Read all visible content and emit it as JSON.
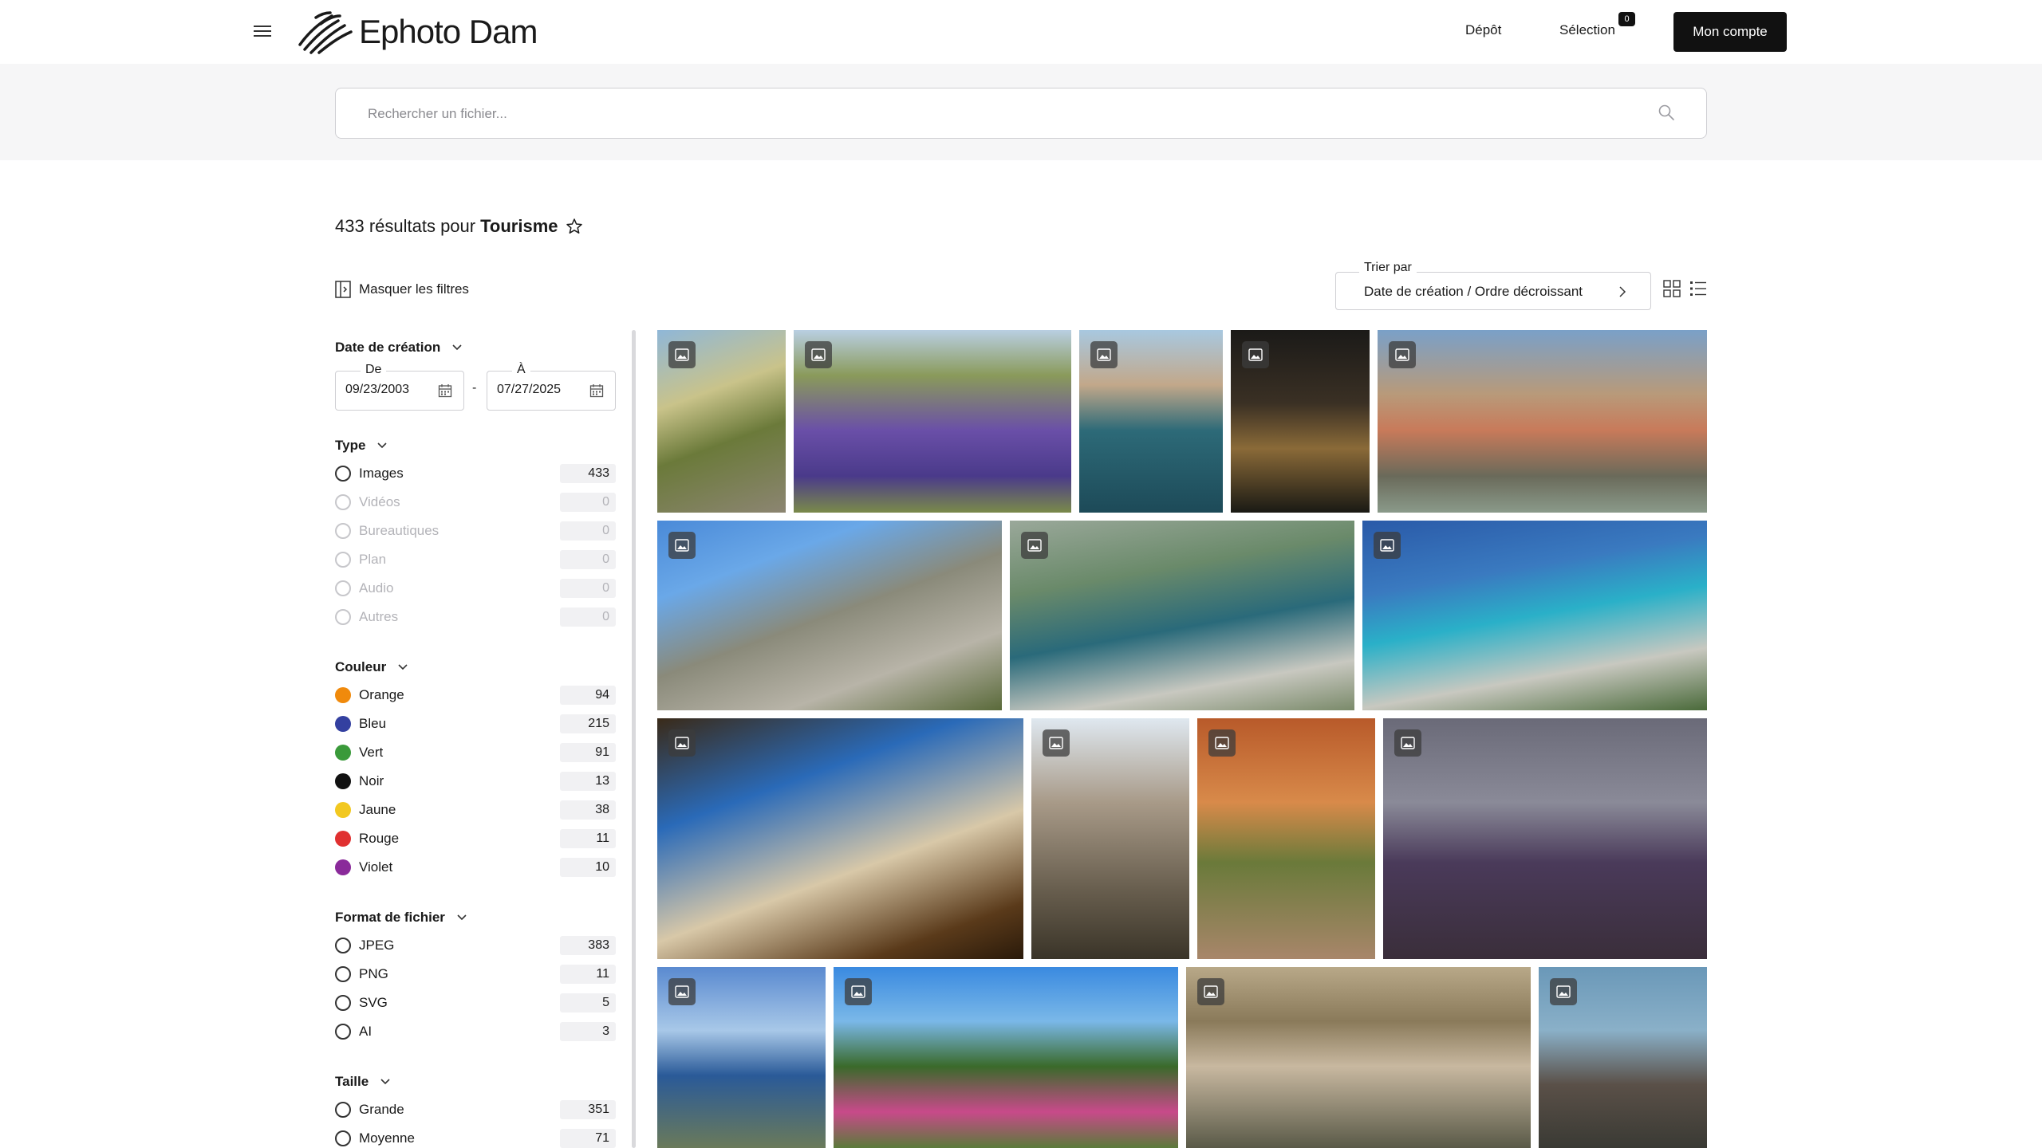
{
  "header": {
    "logo_text": "Ephoto Dam",
    "nav": {
      "depot": "Dépôt",
      "selection": "Sélection",
      "selection_count": "0"
    },
    "account_button": "Mon compte"
  },
  "search": {
    "placeholder": "Rechercher un fichier..."
  },
  "results": {
    "count_text": "433 résultats pour",
    "query": "Tourisme"
  },
  "filters_toggle": "Masquer les filtres",
  "sort": {
    "caption": "Trier par",
    "value": "Date de création / Ordre décroissant"
  },
  "filters": {
    "date": {
      "title": "Date de création",
      "from_label": "De",
      "from_value": "09/23/2003",
      "to_label": "À",
      "to_value": "07/27/2025"
    },
    "type": {
      "title": "Type",
      "items": [
        {
          "label": "Images",
          "count": "433",
          "enabled": true
        },
        {
          "label": "Vidéos",
          "count": "0",
          "enabled": false
        },
        {
          "label": "Bureautiques",
          "count": "0",
          "enabled": false
        },
        {
          "label": "Plan",
          "count": "0",
          "enabled": false
        },
        {
          "label": "Audio",
          "count": "0",
          "enabled": false
        },
        {
          "label": "Autres",
          "count": "0",
          "enabled": false
        }
      ]
    },
    "color": {
      "title": "Couleur",
      "items": [
        {
          "label": "Orange",
          "count": "94",
          "color": "#f08a0c"
        },
        {
          "label": "Bleu",
          "count": "215",
          "color": "#3340a0"
        },
        {
          "label": "Vert",
          "count": "91",
          "color": "#3a9a3a"
        },
        {
          "label": "Noir",
          "count": "13",
          "color": "#111111"
        },
        {
          "label": "Jaune",
          "count": "38",
          "color": "#f2c820"
        },
        {
          "label": "Rouge",
          "count": "11",
          "color": "#e03030"
        },
        {
          "label": "Violet",
          "count": "10",
          "color": "#8a2a9a"
        }
      ]
    },
    "format": {
      "title": "Format de fichier",
      "items": [
        {
          "label": "JPEG",
          "count": "383"
        },
        {
          "label": "PNG",
          "count": "11"
        },
        {
          "label": "SVG",
          "count": "5"
        },
        {
          "label": "AI",
          "count": "3"
        }
      ]
    },
    "size": {
      "title": "Taille",
      "items": [
        {
          "label": "Grande",
          "count": "351"
        },
        {
          "label": "Moyenne",
          "count": "71"
        }
      ]
    }
  },
  "gallery": {
    "badge_icon": "image-icon",
    "tiles": [
      {
        "name": "photo-stone-path",
        "background": "linear-gradient(160deg,#8fb7d8 0%,#c9c38a 35%,#6b7a3a 60%,#8c8572 100%)"
      },
      {
        "name": "photo-lavender-field",
        "background": "linear-gradient(180deg,#b9cfe2 0%,#8a9a5a 25%,#6a4fa8 55%,#4a3a8a 80%,#7a8a4a 100%)"
      },
      {
        "name": "photo-harbor-aerial",
        "background": "linear-gradient(180deg,#a8c8e0 0%,#c2a88a 30%,#2d6a78 55%,#1d4a58 100%)"
      },
      {
        "name": "photo-hotel-facade-night",
        "background": "linear-gradient(180deg,#1b1a18 0%,#3a3024 40%,#8a6a38 65%,#1a1a14 100%)"
      },
      {
        "name": "photo-old-bridge-village",
        "background": "linear-gradient(180deg,#7aa0c8 0%,#b89a7a 35%,#c87a5a 55%,#6a6a5a 80%,#8a9a8a 100%)"
      },
      {
        "name": "photo-coastal-cliff",
        "background": "linear-gradient(160deg,#4a8ad8 0%,#6aa8e8 25%,#8a8a7a 50%,#b8b4a8 75%,#5a6a3a 100%)"
      },
      {
        "name": "photo-calanque-port",
        "background": "linear-gradient(170deg,#9aa89a 0%,#6a8a6a 30%,#2a6a7a 55%,#c8c8c0 80%,#7a8a6a 100%)"
      },
      {
        "name": "photo-calanque-turquoise",
        "background": "linear-gradient(170deg,#2a5aa8 0%,#3a7ac0 30%,#2ab0c8 50%,#c8c8c0 75%,#4a6a3a 100%)"
      },
      {
        "name": "photo-palace-trees",
        "background": "linear-gradient(160deg,#3a2a18 0%,#2a6ab8 30%,#d8c8a8 60%,#5a3a1a 85%,#2a1a0a 100%)"
      },
      {
        "name": "photo-stone-alley-lantern",
        "background": "linear-gradient(180deg,#dfe8f0 0%,#a89a88 35%,#6a6050 70%,#3a3428 100%)"
      },
      {
        "name": "photo-red-arch-street",
        "background": "linear-gradient(180deg,#b85a2a 0%,#d88a4a 35%,#6a7a3a 60%,#a8866a 100%)"
      },
      {
        "name": "photo-lavender-dusk",
        "background": "linear-gradient(180deg,#6a6a78 0%,#8a8a98 35%,#4a3a5a 60%,#3a2e3a 100%)"
      },
      {
        "name": "photo-sea-village",
        "background": "linear-gradient(180deg,#5a8ad0 0%,#a8c8e8 35%,#2a5a98 60%,#6a7a5a 100%)"
      },
      {
        "name": "photo-hill-village-flowers",
        "background": "linear-gradient(180deg,#3a8ae0 0%,#7ab8e8 30%,#3a6a2a 55%,#c84a8a 80%,#5a7a3a 100%)"
      },
      {
        "name": "photo-beach-city",
        "background": "linear-gradient(180deg,#b8a888 0%,#8a7a5a 30%,#c8b8a0 55%,#5a5a48 100%)"
      },
      {
        "name": "photo-church-tower",
        "background": "linear-gradient(180deg,#6a98b8 0%,#8ab0c8 35%,#5a5048 65%,#3a3a34 100%)"
      }
    ]
  }
}
